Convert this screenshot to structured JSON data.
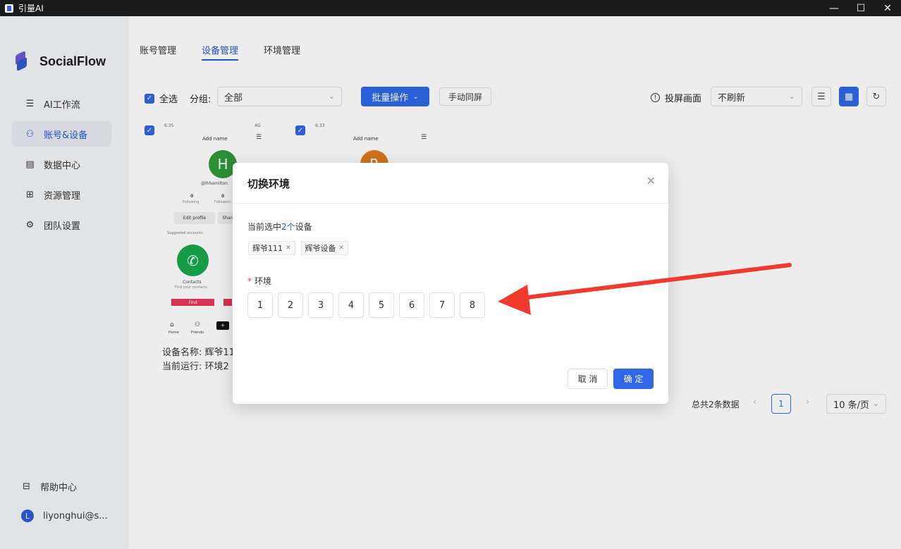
{
  "window": {
    "title": "引量AI",
    "minimize": "—",
    "maximize": "☐",
    "close": "✕"
  },
  "brand": {
    "name": "SocialFlow"
  },
  "sidebar": {
    "items": [
      {
        "label": "AI工作流",
        "icon": "workflow-icon",
        "glyph": "☰"
      },
      {
        "label": "账号&设备",
        "icon": "users-icon",
        "glyph": "⚇"
      },
      {
        "label": "数据中心",
        "icon": "database-icon",
        "glyph": "▤"
      },
      {
        "label": "资源管理",
        "icon": "grid-icon",
        "glyph": "⊞"
      },
      {
        "label": "团队设置",
        "icon": "gear-icon",
        "glyph": "⚙"
      }
    ],
    "help": {
      "label": "帮助中心",
      "glyph": "⊟"
    },
    "user": {
      "initial": "L",
      "name": "liyonghui@s..."
    }
  },
  "tabs": [
    {
      "label": "账号管理"
    },
    {
      "label": "设备管理"
    },
    {
      "label": "环境管理"
    }
  ],
  "toolbar": {
    "select_all": "全选",
    "group_label": "分组:",
    "group_value": "全部",
    "batch": "批量操作",
    "sync": "手动同屏",
    "cast": "投屏画面",
    "refresh_value": "不刷新"
  },
  "devices": [
    {
      "status_left": "6:35",
      "status_right": "4G",
      "name_pill": "Add name",
      "avatar_letter": "H",
      "handle": "@lhhamilton",
      "following": "0",
      "followers": "0",
      "following_label": "Following",
      "followers_label": "Followers",
      "edit_profile": "Edit profile",
      "share": "Share",
      "suggested": "Suggested accounts",
      "contacts": "Contacts",
      "contacts_sub": "Find your contacts",
      "find": "Find",
      "nav_home": "Home",
      "nav_friends": "Friends",
      "device_name": "设备名称: 辉爷11",
      "current_run": "当前运行: 环境2"
    },
    {
      "status_left": "6:33",
      "name_pill": "Add name",
      "avatar_letter": "R"
    }
  ],
  "pager": {
    "total": "总共2条数据",
    "prev": "‹",
    "page": "1",
    "next": "›",
    "page_size": "10 条/页"
  },
  "modal": {
    "title": "切换环境",
    "selected_prefix": "当前选中",
    "selected_count": "2个",
    "selected_suffix": "设备",
    "tags": [
      {
        "label": "辉爷111"
      },
      {
        "label": "辉爷设备"
      }
    ],
    "env_required": "*",
    "env_label": "环境",
    "env_options": [
      "1",
      "2",
      "3",
      "4",
      "5",
      "6",
      "7",
      "8"
    ],
    "cancel": "取 消",
    "confirm": "确 定"
  },
  "colors": {
    "accent": "#2f67e6",
    "arrow": "#f03a2e",
    "tiktok_green": "#18a84b",
    "avatar_h": "#2e9a3a",
    "avatar_r": "#e07a1f"
  }
}
